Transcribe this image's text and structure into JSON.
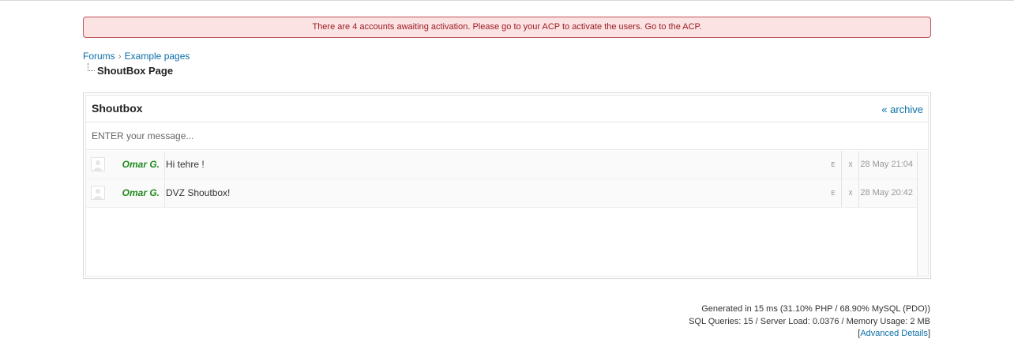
{
  "alert": {
    "text": "There are 4 accounts awaiting activation. Please go to your ACP to activate the users. Go to the ACP."
  },
  "breadcrumb": {
    "items": [
      "Forums",
      "Example pages"
    ],
    "separator": "›",
    "current": "ShoutBox Page"
  },
  "shoutbox": {
    "title": "Shoutbox",
    "archive_label": "« archive",
    "input_placeholder": "ENTER your message...",
    "shouts": [
      {
        "author": "Omar G.",
        "message": "Hi tehre !",
        "edit": "E",
        "delete": "X",
        "time": "28 May 21:04"
      },
      {
        "author": "Omar G.",
        "message": "DVZ Shoutbox!",
        "edit": "E",
        "delete": "X",
        "time": "28 May 20:42"
      }
    ]
  },
  "footer": {
    "generated": "Generated in 15 ms (31.10% PHP / 68.90% MySQL (PDO))",
    "stats": "SQL Queries: 15 / Server Load: 0.0376 / Memory Usage: 2 MB",
    "bracket_open": "[",
    "advanced_link": "Advanced Details",
    "bracket_close": "]"
  },
  "colors": {
    "alert_bg": "#fbe3e4",
    "alert_border": "#c0535a",
    "alert_text": "#9b1c22",
    "link": "#0b6fa8",
    "author": "#1f8a1f"
  }
}
